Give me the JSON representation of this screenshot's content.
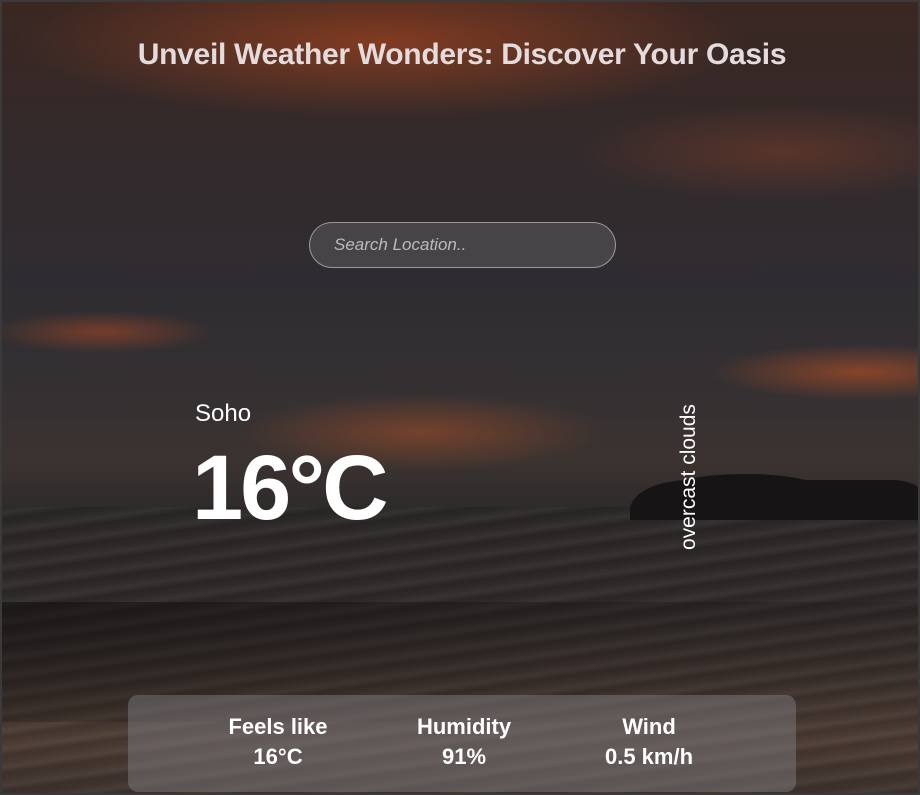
{
  "header": {
    "title": "Unveil Weather Wonders: Discover Your Oasis"
  },
  "search": {
    "placeholder": "Search Location..",
    "value": ""
  },
  "weather": {
    "location": "Soho",
    "temperature": "16°C",
    "condition": "overcast clouds"
  },
  "details": {
    "feels_like": {
      "label": "Feels like",
      "value": "16°C"
    },
    "humidity": {
      "label": "Humidity",
      "value": "91%"
    },
    "wind": {
      "label": "Wind",
      "value": "0.5 km/h"
    }
  }
}
